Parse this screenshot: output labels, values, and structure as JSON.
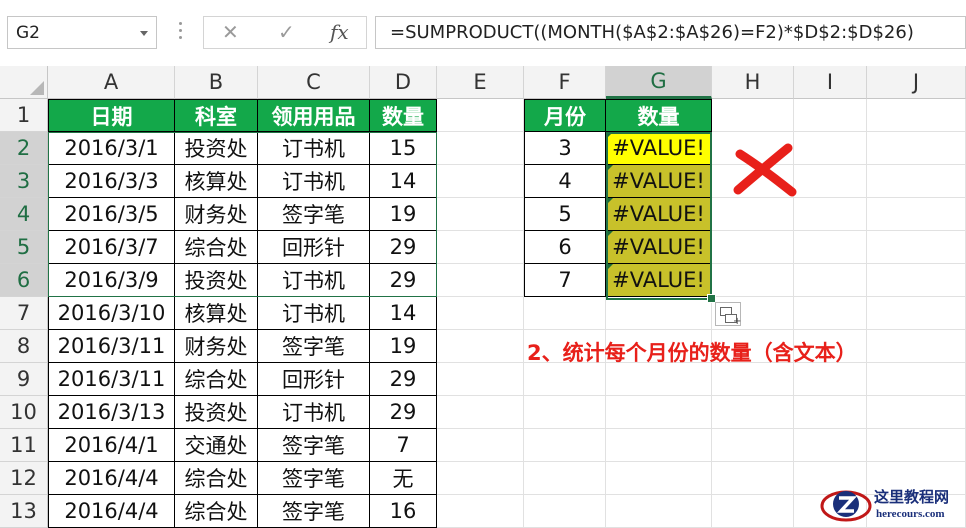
{
  "formula_bar": {
    "name_box": "G2",
    "cancel_icon": "✕",
    "enter_icon": "✓",
    "fx_label": "fx",
    "formula": "=SUMPRODUCT((MONTH($A$2:$A$26)=F2)*$D$2:$D$26)"
  },
  "columns": [
    "A",
    "B",
    "C",
    "D",
    "E",
    "F",
    "G",
    "H",
    "I",
    "J"
  ],
  "rows": [
    "1",
    "2",
    "3",
    "4",
    "5",
    "6",
    "7",
    "8",
    "9",
    "10",
    "11",
    "12",
    "13"
  ],
  "table": {
    "headers": [
      "日期",
      "科室",
      "领用用品",
      "数量"
    ],
    "data": [
      [
        "2016/3/1",
        "投资处",
        "订书机",
        "15"
      ],
      [
        "2016/3/3",
        "核算处",
        "订书机",
        "14"
      ],
      [
        "2016/3/5",
        "财务处",
        "签字笔",
        "19"
      ],
      [
        "2016/3/7",
        "综合处",
        "回形针",
        "29"
      ],
      [
        "2016/3/9",
        "投资处",
        "订书机",
        "29"
      ],
      [
        "2016/3/10",
        "核算处",
        "订书机",
        "14"
      ],
      [
        "2016/3/11",
        "财务处",
        "签字笔",
        "19"
      ],
      [
        "2016/3/11",
        "综合处",
        "回形针",
        "29"
      ],
      [
        "2016/3/13",
        "投资处",
        "订书机",
        "29"
      ],
      [
        "2016/4/1",
        "交通处",
        "签字笔",
        "7"
      ],
      [
        "2016/4/4",
        "综合处",
        "签字笔",
        "无"
      ],
      [
        "2016/4/4",
        "综合处",
        "签字笔",
        "16"
      ]
    ]
  },
  "summary": {
    "headers": [
      "月份",
      "数量"
    ],
    "months": [
      "3",
      "4",
      "5",
      "6",
      "7"
    ],
    "results": [
      "#VALUE!",
      "#VALUE!",
      "#VALUE!",
      "#VALUE!",
      "#VALUE!"
    ]
  },
  "annotation": "2、统计每个月份的数量（含文本）",
  "watermark": {
    "title": "这里教程网",
    "url": "herecours.com"
  },
  "colors": {
    "header_green": "#13a84a",
    "error_yellow": "#ffff00",
    "error_olive": "#c8c12a",
    "note_red": "#e8201a",
    "cross_red": "#e8201a"
  }
}
